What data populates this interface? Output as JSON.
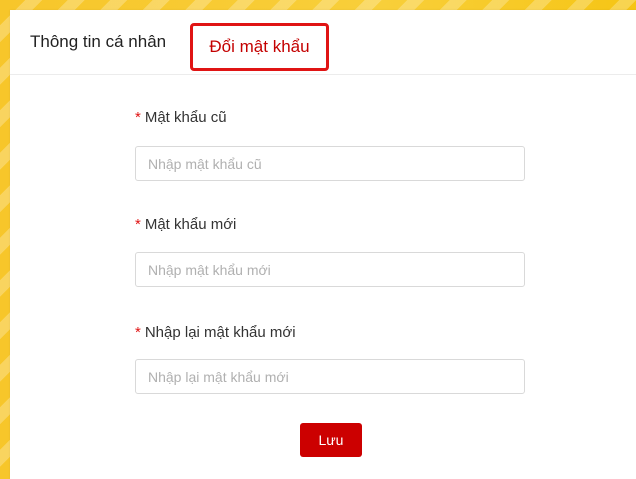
{
  "tabs": {
    "personal_info": "Thông tin cá nhân",
    "change_password": "Đổi mật khẩu"
  },
  "form": {
    "required_mark": "*",
    "old_password": {
      "label": "Mật khẩu cũ",
      "placeholder": "Nhập mật khẩu cũ",
      "value": ""
    },
    "new_password": {
      "label": "Mật khẩu mới",
      "placeholder": "Nhập mật khẩu mới",
      "value": ""
    },
    "confirm_password": {
      "label": "Nhập lại mật khẩu mới",
      "placeholder": "Nhập lại mật khẩu mới",
      "value": ""
    },
    "save_label": "Lưu"
  },
  "colors": {
    "accent": "#cc0000",
    "active_tab_border": "#e01414",
    "background": "#f6c515"
  }
}
